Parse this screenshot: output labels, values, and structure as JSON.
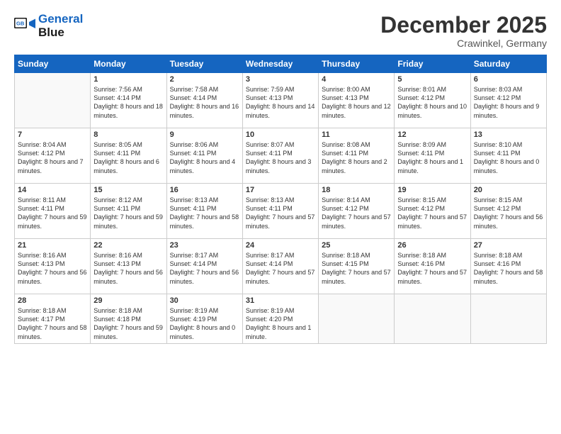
{
  "header": {
    "logo_line1": "General",
    "logo_line2": "Blue",
    "month_title": "December 2025",
    "location": "Crawinkel, Germany"
  },
  "days_of_week": [
    "Sunday",
    "Monday",
    "Tuesday",
    "Wednesday",
    "Thursday",
    "Friday",
    "Saturday"
  ],
  "weeks": [
    [
      {
        "day": "",
        "sunrise": "",
        "sunset": "",
        "daylight": ""
      },
      {
        "day": "1",
        "sunrise": "7:56 AM",
        "sunset": "4:14 PM",
        "daylight": "8 hours and 18 minutes."
      },
      {
        "day": "2",
        "sunrise": "7:58 AM",
        "sunset": "4:14 PM",
        "daylight": "8 hours and 16 minutes."
      },
      {
        "day": "3",
        "sunrise": "7:59 AM",
        "sunset": "4:13 PM",
        "daylight": "8 hours and 14 minutes."
      },
      {
        "day": "4",
        "sunrise": "8:00 AM",
        "sunset": "4:13 PM",
        "daylight": "8 hours and 12 minutes."
      },
      {
        "day": "5",
        "sunrise": "8:01 AM",
        "sunset": "4:12 PM",
        "daylight": "8 hours and 10 minutes."
      },
      {
        "day": "6",
        "sunrise": "8:03 AM",
        "sunset": "4:12 PM",
        "daylight": "8 hours and 9 minutes."
      }
    ],
    [
      {
        "day": "7",
        "sunrise": "8:04 AM",
        "sunset": "4:12 PM",
        "daylight": "8 hours and 7 minutes."
      },
      {
        "day": "8",
        "sunrise": "8:05 AM",
        "sunset": "4:11 PM",
        "daylight": "8 hours and 6 minutes."
      },
      {
        "day": "9",
        "sunrise": "8:06 AM",
        "sunset": "4:11 PM",
        "daylight": "8 hours and 4 minutes."
      },
      {
        "day": "10",
        "sunrise": "8:07 AM",
        "sunset": "4:11 PM",
        "daylight": "8 hours and 3 minutes."
      },
      {
        "day": "11",
        "sunrise": "8:08 AM",
        "sunset": "4:11 PM",
        "daylight": "8 hours and 2 minutes."
      },
      {
        "day": "12",
        "sunrise": "8:09 AM",
        "sunset": "4:11 PM",
        "daylight": "8 hours and 1 minute."
      },
      {
        "day": "13",
        "sunrise": "8:10 AM",
        "sunset": "4:11 PM",
        "daylight": "8 hours and 0 minutes."
      }
    ],
    [
      {
        "day": "14",
        "sunrise": "8:11 AM",
        "sunset": "4:11 PM",
        "daylight": "7 hours and 59 minutes."
      },
      {
        "day": "15",
        "sunrise": "8:12 AM",
        "sunset": "4:11 PM",
        "daylight": "7 hours and 59 minutes."
      },
      {
        "day": "16",
        "sunrise": "8:13 AM",
        "sunset": "4:11 PM",
        "daylight": "7 hours and 58 minutes."
      },
      {
        "day": "17",
        "sunrise": "8:13 AM",
        "sunset": "4:11 PM",
        "daylight": "7 hours and 57 minutes."
      },
      {
        "day": "18",
        "sunrise": "8:14 AM",
        "sunset": "4:12 PM",
        "daylight": "7 hours and 57 minutes."
      },
      {
        "day": "19",
        "sunrise": "8:15 AM",
        "sunset": "4:12 PM",
        "daylight": "7 hours and 57 minutes."
      },
      {
        "day": "20",
        "sunrise": "8:15 AM",
        "sunset": "4:12 PM",
        "daylight": "7 hours and 56 minutes."
      }
    ],
    [
      {
        "day": "21",
        "sunrise": "8:16 AM",
        "sunset": "4:13 PM",
        "daylight": "7 hours and 56 minutes."
      },
      {
        "day": "22",
        "sunrise": "8:16 AM",
        "sunset": "4:13 PM",
        "daylight": "7 hours and 56 minutes."
      },
      {
        "day": "23",
        "sunrise": "8:17 AM",
        "sunset": "4:14 PM",
        "daylight": "7 hours and 56 minutes."
      },
      {
        "day": "24",
        "sunrise": "8:17 AM",
        "sunset": "4:14 PM",
        "daylight": "7 hours and 57 minutes."
      },
      {
        "day": "25",
        "sunrise": "8:18 AM",
        "sunset": "4:15 PM",
        "daylight": "7 hours and 57 minutes."
      },
      {
        "day": "26",
        "sunrise": "8:18 AM",
        "sunset": "4:16 PM",
        "daylight": "7 hours and 57 minutes."
      },
      {
        "day": "27",
        "sunrise": "8:18 AM",
        "sunset": "4:16 PM",
        "daylight": "7 hours and 58 minutes."
      }
    ],
    [
      {
        "day": "28",
        "sunrise": "8:18 AM",
        "sunset": "4:17 PM",
        "daylight": "7 hours and 58 minutes."
      },
      {
        "day": "29",
        "sunrise": "8:18 AM",
        "sunset": "4:18 PM",
        "daylight": "7 hours and 59 minutes."
      },
      {
        "day": "30",
        "sunrise": "8:19 AM",
        "sunset": "4:19 PM",
        "daylight": "8 hours and 0 minutes."
      },
      {
        "day": "31",
        "sunrise": "8:19 AM",
        "sunset": "4:20 PM",
        "daylight": "8 hours and 1 minute."
      },
      {
        "day": "",
        "sunrise": "",
        "sunset": "",
        "daylight": ""
      },
      {
        "day": "",
        "sunrise": "",
        "sunset": "",
        "daylight": ""
      },
      {
        "day": "",
        "sunrise": "",
        "sunset": "",
        "daylight": ""
      }
    ]
  ]
}
